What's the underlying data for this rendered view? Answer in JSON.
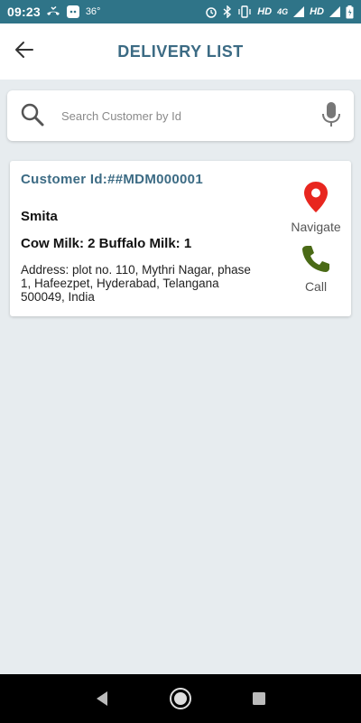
{
  "status_bar": {
    "time": "09:23",
    "temperature": "36°",
    "network_labels": [
      "HD",
      "4G",
      "HD"
    ]
  },
  "header": {
    "title": "DELIVERY LIST"
  },
  "search": {
    "placeholder": "Search Customer by Id",
    "value": ""
  },
  "customers": [
    {
      "customer_id": "Customer Id:##MDM000001",
      "name": "Smita",
      "milk": "Cow Milk: 2 Buffalo Milk: 1",
      "address": "Address: plot no. 110, Mythri Nagar, phase 1, Hafeezpet, Hyderabad, Telangana 500049, India",
      "navigate_label": "Navigate",
      "call_label": "Call"
    }
  ],
  "colors": {
    "status_bar": "#2f7488",
    "title": "#3c6b84",
    "navigate_pin": "#e8261f",
    "call_phone": "#4a6a16",
    "background": "#e7ecef"
  },
  "icons": [
    "back-arrow-icon",
    "search-icon",
    "mic-icon",
    "location-pin-icon",
    "phone-icon",
    "nav-back-icon",
    "nav-home-icon",
    "nav-recents-icon"
  ]
}
